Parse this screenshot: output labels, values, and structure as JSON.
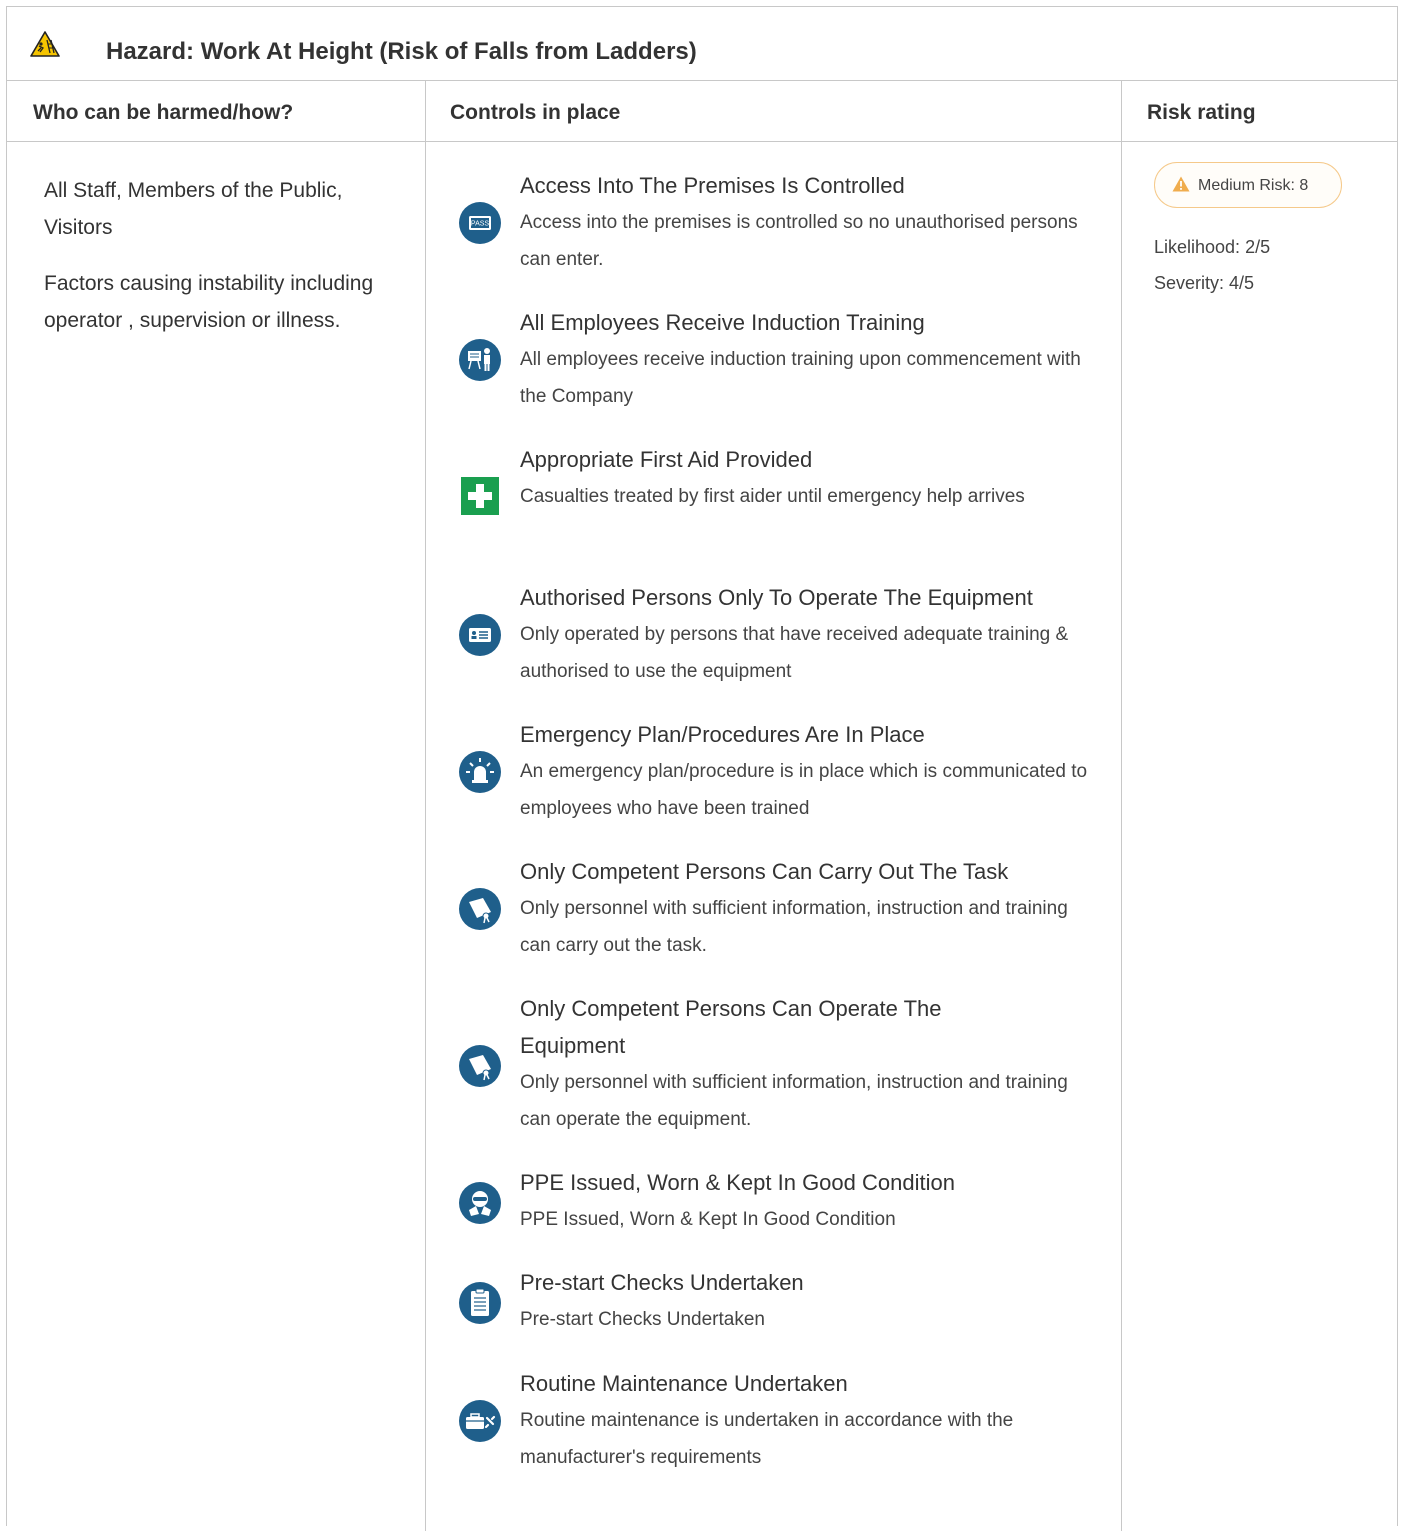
{
  "hazard": {
    "icon": "ladder-fall-warning-icon",
    "title": "Hazard:  Work At Height (Risk of Falls from Ladders)"
  },
  "columns": {
    "who": "Who can be harmed/how?",
    "controls": "Controls in place",
    "risk": "Risk rating"
  },
  "who": {
    "persons": "All Staff, Members of the Public, Visitors",
    "factors": "Factors causing instability including operator , supervision or illness."
  },
  "controls": [
    {
      "icon": "access-pass-icon",
      "title": "Access Into The Premises Is Controlled",
      "description": "Access into the premises is controlled so no unauthorised persons can enter."
    },
    {
      "icon": "induction-training-icon",
      "title": "All Employees Receive Induction Training",
      "description": "All employees receive induction training upon commencement with the Company"
    },
    {
      "icon": "first-aid-icon",
      "title": "Appropriate First Aid Provided",
      "description": "Casualties treated by first aider until emergency help arrives"
    },
    {
      "icon": "authorised-id-card-icon",
      "title": "Authorised Persons Only To Operate The Equipment",
      "description": "Only operated by persons that have received adequate training & authorised to use the equipment"
    },
    {
      "icon": "emergency-beacon-icon",
      "title": "Emergency Plan/Procedures Are In Place",
      "description": "An emergency plan/procedure is in place which is communicated to employees who have been trained"
    },
    {
      "icon": "certificate-icon",
      "title": "Only Competent Persons Can Carry Out The Task",
      "description": "Only personnel with sufficient information, instruction and training can carry out the task."
    },
    {
      "icon": "certificate-icon",
      "title": "Only Competent Persons Can Operate The Equipment",
      "description": "Only personnel with sufficient information, instruction and training can operate the equipment."
    },
    {
      "icon": "ppe-icon",
      "title": "PPE Issued, Worn & Kept In Good Condition",
      "description": "PPE Issued, Worn & Kept In Good Condition"
    },
    {
      "icon": "clipboard-checklist-icon",
      "title": "Pre-start Checks Undertaken",
      "description": "Pre-start Checks Undertaken"
    },
    {
      "icon": "toolbox-icon",
      "title": "Routine Maintenance Undertaken",
      "description": "Routine maintenance is undertaken in accordance with the manufacturer's requirements"
    }
  ],
  "risk": {
    "badge": "Medium Risk: 8",
    "likelihood": "Likelihood: 2/5",
    "severity": "Severity: 4/5",
    "badge_color": "#f0ad4e"
  },
  "colors": {
    "icon_blue": "#1f5f8b",
    "first_aid_green": "#1a9f4f",
    "border": "#c8c8c8"
  }
}
